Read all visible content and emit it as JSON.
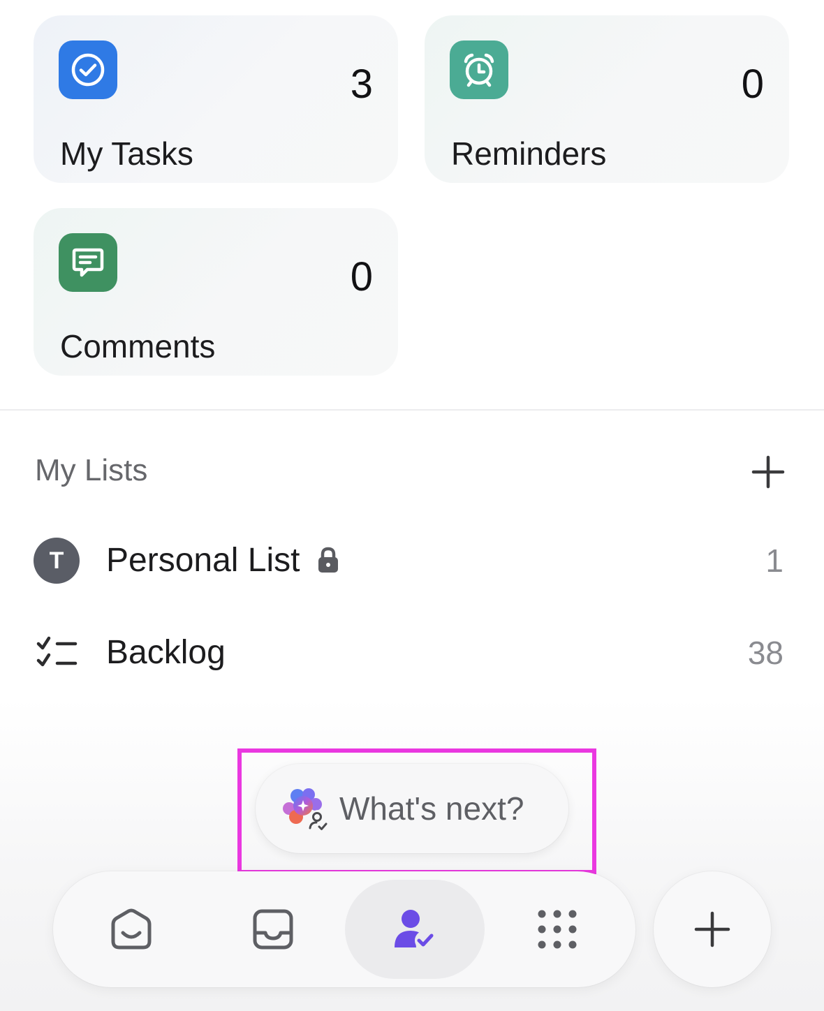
{
  "cards": [
    {
      "label": "My Tasks",
      "count": "3",
      "icon": "check-circle-icon",
      "color": "#2f7ae5"
    },
    {
      "label": "Reminders",
      "count": "0",
      "icon": "alarm-clock-icon",
      "color": "#4bab94"
    },
    {
      "label": "Comments",
      "count": "0",
      "icon": "comment-icon",
      "color": "#3f9161"
    }
  ],
  "lists": {
    "title": "My Lists",
    "items": [
      {
        "label": "Personal List",
        "count": "1",
        "avatar": "T",
        "locked": true
      },
      {
        "label": "Backlog",
        "count": "38",
        "icon": "checklist-icon"
      }
    ]
  },
  "ai": {
    "label": "What's next?"
  },
  "nav": {
    "items": [
      {
        "name": "home",
        "icon": "home-icon"
      },
      {
        "name": "inbox",
        "icon": "inbox-icon"
      },
      {
        "name": "my-work",
        "icon": "user-check-icon",
        "active": true
      },
      {
        "name": "more",
        "icon": "grid-dots-icon"
      }
    ]
  },
  "colors": {
    "accent": "#6b4ce6",
    "highlight": "#ea38e0"
  }
}
